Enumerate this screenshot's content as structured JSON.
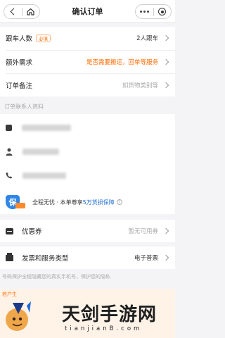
{
  "header": {
    "title": "确认订单",
    "back_icon": "chevron-left-icon",
    "home_icon": "home-icon",
    "more_icon": "more-dots-icon",
    "close_icon": "target-icon"
  },
  "order": {
    "rows": [
      {
        "label": "跟车人数",
        "badge": "必填",
        "value": "2人跟车",
        "value_color": "#333333"
      },
      {
        "label": "额外需求",
        "badge": "",
        "value": "是否需要搬运，回单等服务",
        "value_color": "#ff6a00"
      },
      {
        "label": "订单备注",
        "badge": "",
        "value": "如货物类别等",
        "value_color": "#aaaaaa"
      }
    ]
  },
  "contact": {
    "section_label": "订单联系人资料"
  },
  "guarantee": {
    "text_prefix": "全程无忧 · 本单尊享",
    "text_highlight": "5万货损保障",
    "help_glyph": "?"
  },
  "coupon": {
    "label": "优惠券",
    "value": "暂无可用券"
  },
  "invoice": {
    "label": "发票和服务类型",
    "value": "电子普票"
  },
  "notice": {
    "privacy_text": "号码保护全程隐藏您的真实手机号，保护您的隐私",
    "strip_text": "若产生"
  },
  "watermark": {
    "title": "天剑手游网",
    "url": "tianjianB.com"
  },
  "colors": {
    "accent_orange": "#ff6a00",
    "accent_blue": "#1f6fd6",
    "background": "#f4f4f6"
  }
}
